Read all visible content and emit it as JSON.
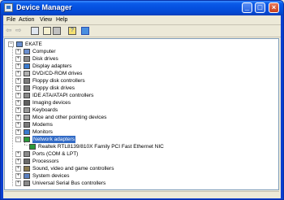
{
  "window": {
    "title": "Device Manager"
  },
  "menu": {
    "items": [
      {
        "label": "File"
      },
      {
        "label": "Action"
      },
      {
        "label": "View"
      },
      {
        "label": "Help"
      }
    ]
  },
  "toolbar": {
    "icons": [
      "back-arrow",
      "forward-arrow",
      "view-devices",
      "properties",
      "print",
      "help",
      "scan-hardware"
    ]
  },
  "tree": {
    "root": "EKATE",
    "categories": [
      {
        "label": "Computer",
        "icon": "computer-icon",
        "color": "#6a8fd0"
      },
      {
        "label": "Disk drives",
        "icon": "disk-drive-icon",
        "color": "#8a8a8a"
      },
      {
        "label": "Display adapters",
        "icon": "display-adapter-icon",
        "color": "#3a7bd0"
      },
      {
        "label": "DVD/CD-ROM drives",
        "icon": "cd-drive-icon",
        "color": "#b0b0b0"
      },
      {
        "label": "Floppy disk controllers",
        "icon": "floppy-controller-icon",
        "color": "#7a7a7a"
      },
      {
        "label": "Floppy disk drives",
        "icon": "floppy-drive-icon",
        "color": "#7a7a7a"
      },
      {
        "label": "IDE ATA/ATAPI controllers",
        "icon": "ide-controller-icon",
        "color": "#8a8a8a"
      },
      {
        "label": "Imaging devices",
        "icon": "camera-icon",
        "color": "#606060"
      },
      {
        "label": "Keyboards",
        "icon": "keyboard-icon",
        "color": "#9a9a9a"
      },
      {
        "label": "Mice and other pointing devices",
        "icon": "mouse-icon",
        "color": "#a0a0a0"
      },
      {
        "label": "Modems",
        "icon": "modem-icon",
        "color": "#7a7a7a"
      },
      {
        "label": "Monitors",
        "icon": "monitor-icon",
        "color": "#3a7bd0"
      },
      {
        "label": "Network adapters",
        "icon": "network-adapter-icon",
        "color": "#2a9a3a",
        "selected": true,
        "expanded": true
      },
      {
        "label": "Ports (COM & LPT)",
        "icon": "port-icon",
        "color": "#8a8a8a"
      },
      {
        "label": "Processors",
        "icon": "processor-icon",
        "color": "#6a6a6a"
      },
      {
        "label": "Sound, video and game controllers",
        "icon": "sound-icon",
        "color": "#8a7a50"
      },
      {
        "label": "System devices",
        "icon": "system-device-icon",
        "color": "#5a7fc0"
      },
      {
        "label": "Universal Serial Bus controllers",
        "icon": "usb-icon",
        "color": "#8a8a8a"
      }
    ],
    "network_child": {
      "label": "Realtek RTL8139/810X Family PCI Fast Ethernet NIC",
      "icon": "nic-icon",
      "color": "#2a9a3a"
    }
  }
}
